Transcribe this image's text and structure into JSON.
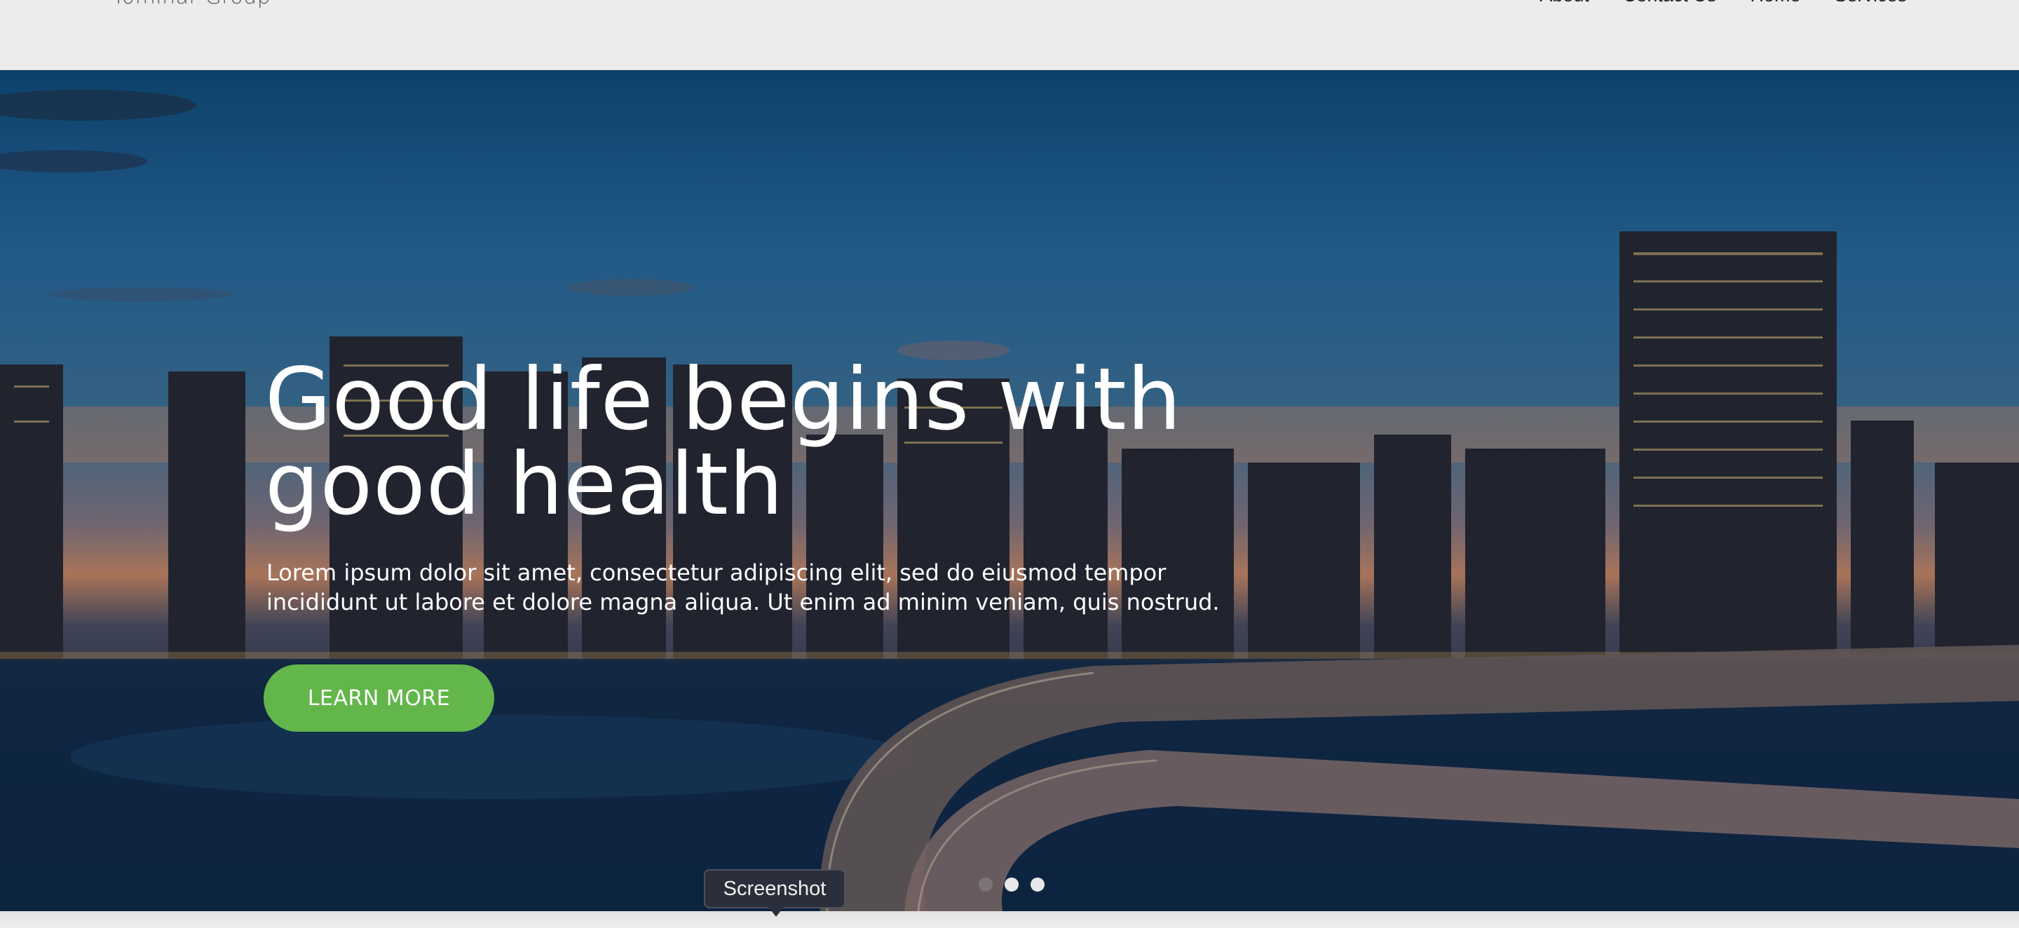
{
  "header": {
    "logo_text": "Tominar Group",
    "nav": [
      {
        "label": "About"
      },
      {
        "label": "Contact Us"
      },
      {
        "label": "Home"
      },
      {
        "label": "Services"
      }
    ]
  },
  "hero": {
    "title": "Good life begins with good health",
    "description": "Lorem ipsum dolor sit amet, consectetur adipiscing elit, sed do eiusmod tempor incididunt ut labore et dolore magna aliqua. Ut enim ad minim veniam, quis nostrud.",
    "cta_label": "LEARN MORE",
    "cta_color": "#62b64a",
    "slides_total": 3,
    "active_slide": 2
  },
  "tooltip": {
    "text": "Screenshot"
  }
}
